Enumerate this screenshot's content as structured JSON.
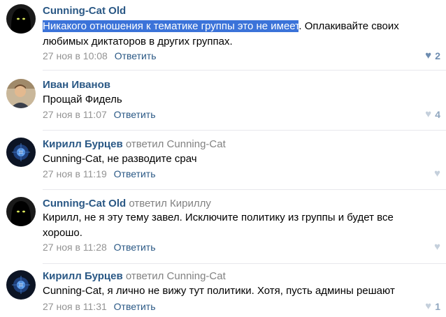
{
  "comments": [
    {
      "author": "Cunning-Cat Old",
      "replied": "",
      "reply_to": "",
      "text_highlight": "Никакого отношения к тематике группы это не имеет",
      "text_rest": ". Оплакивайте своих любимых диктаторов в других группах.",
      "date": "27 ноя в 10:08",
      "reply_label": "Ответить",
      "likes": "2"
    },
    {
      "author": "Иван Иванов",
      "replied": "",
      "reply_to": "",
      "text": "Прощай Фидель",
      "date": "27 ноя в 11:07",
      "reply_label": "Ответить",
      "likes": "4"
    },
    {
      "author": "Кирилл Бурцев",
      "replied": "ответил",
      "reply_to": "Cunning-Cat",
      "text": "Cunning-Cat, не разводите срач",
      "date": "27 ноя в 11:19",
      "reply_label": "Ответить",
      "likes": ""
    },
    {
      "author": "Cunning-Cat Old",
      "replied": "ответил",
      "reply_to": "Кириллу",
      "text": "Кирилл, не я эту тему завел. Исключите политику из группы и будет все хорошо.",
      "date": "27 ноя в 11:28",
      "reply_label": "Ответить",
      "likes": ""
    },
    {
      "author": "Кирилл Бурцев",
      "replied": "ответил",
      "reply_to": "Cunning-Cat",
      "text": "Cunning-Cat, я лично не вижу тут политики. Хотя, пусть админы решают",
      "date": "27 ноя в 11:31",
      "reply_label": "Ответить",
      "likes": "1"
    }
  ],
  "icons": {
    "like": "heart-icon",
    "avatar_cat": "hooded-figure-avatar",
    "avatar_ivan": "man-photo-avatar",
    "avatar_kirill": "blue-orb-avatar"
  },
  "colors": {
    "author": "#2a5885",
    "meta": "#939393",
    "highlight_bg": "#3b73d9",
    "separator": "#e7e8ec",
    "like": "#6d8cb0"
  }
}
